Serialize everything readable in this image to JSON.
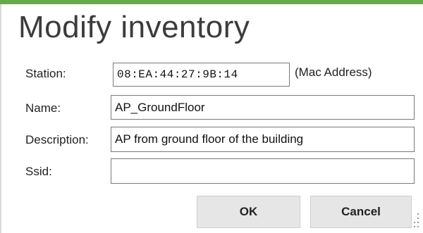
{
  "window": {
    "title": "Modify inventory"
  },
  "form": {
    "station": {
      "label": "Station:",
      "value": "08:EA:44:27:9B:14",
      "hint": "(Mac Address)"
    },
    "name": {
      "label": "Name:",
      "value": "AP_GroundFloor"
    },
    "description": {
      "label": "Description:",
      "value": "AP from ground floor of the building"
    },
    "ssid": {
      "label": "Ssid:",
      "value": ""
    }
  },
  "buttons": {
    "ok_label": "OK",
    "cancel_label": "Cancel"
  },
  "colors": {
    "accent": "#6aa84f",
    "button_bg": "#e6e6e6",
    "field_border": "#7a7a7a"
  }
}
